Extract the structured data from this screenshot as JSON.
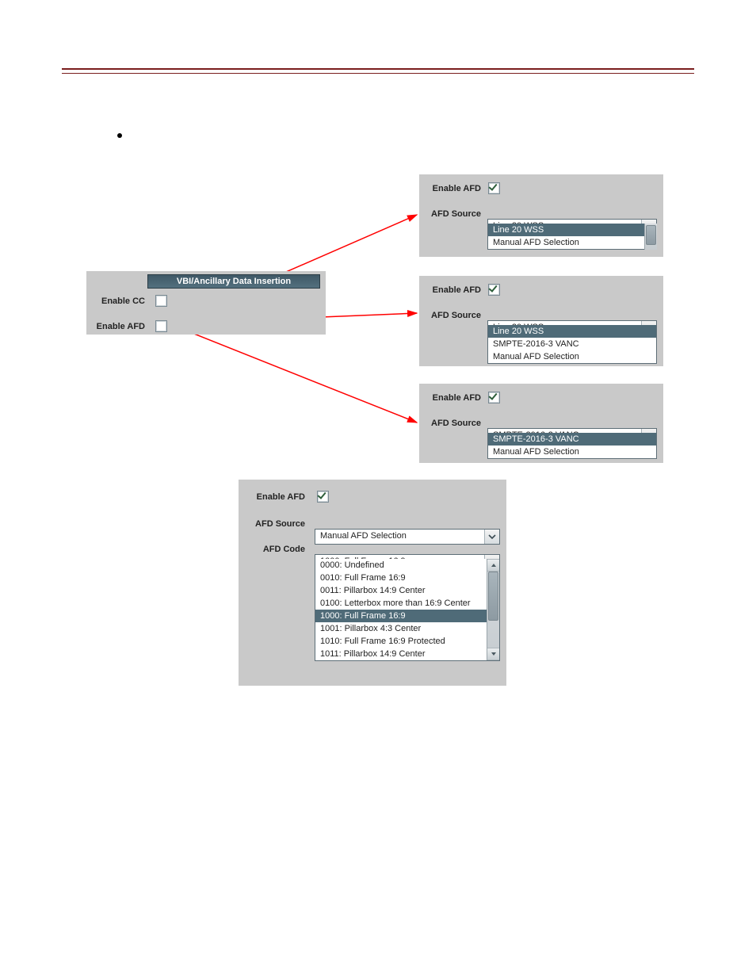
{
  "left_panel": {
    "title": "VBI/Ancillary Data Insertion",
    "enable_cc_label": "Enable CC",
    "enable_afd_label": "Enable AFD"
  },
  "panel_a": {
    "enable_afd_label": "Enable AFD",
    "afd_source_label": "AFD Source",
    "selected": "Line 20 WSS",
    "options": [
      "Line 20 WSS",
      "Manual AFD Selection"
    ],
    "highlight_index": 0
  },
  "panel_b": {
    "enable_afd_label": "Enable AFD",
    "afd_source_label": "AFD Source",
    "selected": "Line 20 WSS",
    "options": [
      "Line 20 WSS",
      "SMPTE-2016-3 VANC",
      "Manual AFD Selection"
    ],
    "highlight_index": 0
  },
  "panel_c": {
    "enable_afd_label": "Enable AFD",
    "afd_source_label": "AFD Source",
    "selected": "SMPTE-2016-3 VANC",
    "options": [
      "SMPTE-2016-3 VANC",
      "Manual AFD Selection"
    ],
    "highlight_index": 0
  },
  "panel_d": {
    "enable_afd_label": "Enable AFD",
    "afd_source_label": "AFD Source",
    "afd_source_selected": "Manual AFD Selection",
    "afd_code_label": "AFD Code",
    "afd_code_selected": "1000: Full Frame 16:9",
    "afd_code_options": [
      "0000: Undefined",
      "0010: Full Frame 16:9",
      "0011: Pillarbox 14:9 Center",
      "0100: Letterbox more than 16:9 Center",
      "1000: Full Frame 16:9",
      "1001: Pillarbox 4:3 Center",
      "1010: Full Frame 16:9 Protected",
      "1011: Pillarbox 14:9 Center"
    ],
    "afd_code_highlight_index": 4
  }
}
